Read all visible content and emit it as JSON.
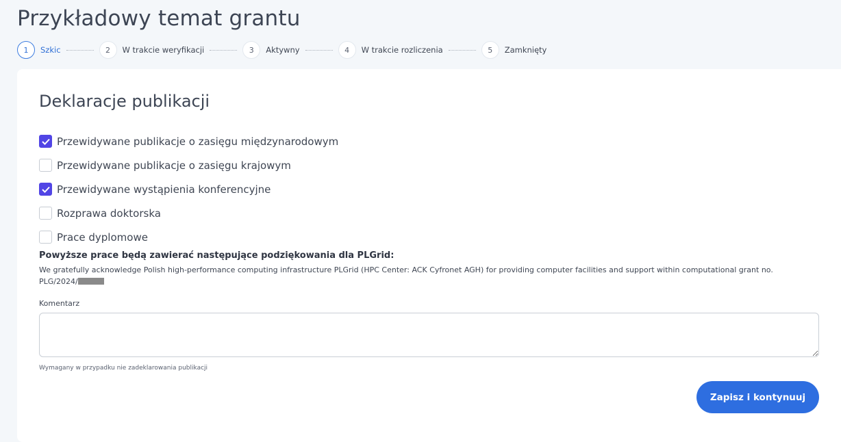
{
  "page": {
    "title": "Przykładowy temat grantu"
  },
  "stepper": {
    "steps": [
      {
        "number": "1",
        "label": "Szkic",
        "active": true
      },
      {
        "number": "2",
        "label": "W trakcie weryfikacji",
        "active": false
      },
      {
        "number": "3",
        "label": "Aktywny",
        "active": false
      },
      {
        "number": "4",
        "label": "W trakcie rozliczenia",
        "active": false
      },
      {
        "number": "5",
        "label": "Zamknięty",
        "active": false
      }
    ]
  },
  "form": {
    "section_title": "Deklaracje publikacji",
    "checkboxes": [
      {
        "label": "Przewidywane publikacje o zasięgu międzynarodowym",
        "checked": true
      },
      {
        "label": "Przewidywane publikacje o zasięgu krajowym",
        "checked": false
      },
      {
        "label": "Przewidywane wystąpienia konferencyjne",
        "checked": true
      },
      {
        "label": "Rozprawa doktorska",
        "checked": false
      },
      {
        "label": "Prace dyplomowe",
        "checked": false
      }
    ],
    "ack_heading": "Powyższe prace będą zawierać następujące podziękowania dla PLGrid:",
    "ack_text": "We gratefully acknowledge Polish high-performance computing infrastructure PLGrid (HPC Center: ACK Cyfronet AGH) for providing computer facilities and support within computational grant no. PLG/2024/",
    "comment_label": "Komentarz",
    "comment_value": "",
    "helper_text": "Wymagany w przypadku nie zadeklarowania publikacji",
    "submit_label": "Zapisz i kontynuuj"
  },
  "colors": {
    "accent": "#2e6ee0",
    "checkbox_checked": "#5145e5",
    "background": "#f4f7fa"
  }
}
